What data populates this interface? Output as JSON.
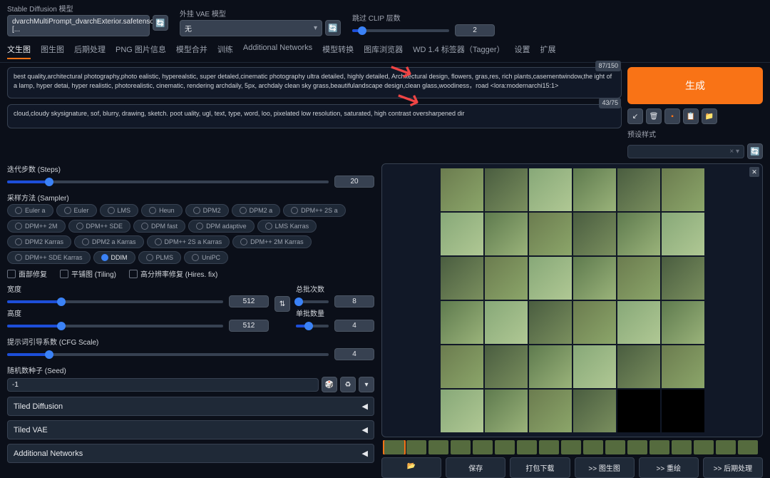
{
  "header": {
    "model_label": "Stable Diffusion 模型",
    "model_value": "dvarchMultiPrompt_dvarchExterior.safetensors [...",
    "vae_label": "外挂 VAE 模型",
    "vae_value": "无",
    "clip_label": "跳过 CLIP 层数",
    "clip_value": "2"
  },
  "tabs": [
    "文生图",
    "图生图",
    "后期处理",
    "PNG 图片信息",
    "模型合并",
    "训练",
    "Additional Networks",
    "模型转换",
    "图库浏览器",
    "WD 1.4 标签器（Tagger）",
    "设置",
    "扩展"
  ],
  "prompt": {
    "pos": "best quality,architectural photography,photo ealistic, hyperealstic, super detaled,cinematic photography ultra detailed, highly detailed, Architectural design, flowers, gras,res, rich plants,casementwindow,the ight of a lamp, hyper detai, hyper realistic, photorealistic, cinematic, rendering archdaily, 5px, archdaly clean sky grass,beautifulandscape design,clean glass,woodiness，road <lora:modernarchi15:1>",
    "pos_count": "87/150",
    "neg": "cloud,cloudy skysignature, sof, blurry, drawing, sketch. poot uality, ugl, text, type, word, loo, pixelated low resolution, saturated, high contrast oversharpened dir",
    "neg_count": "43/75"
  },
  "gen_btn": "生成",
  "preset_label": "预设样式",
  "preset_placeholder": "× ▾",
  "settings": {
    "steps_label": "迭代步数 (Steps)",
    "steps_value": "20",
    "sampler_label": "采样方法 (Sampler)",
    "samplers": [
      "Euler a",
      "Euler",
      "LMS",
      "Heun",
      "DPM2",
      "DPM2 a",
      "DPM++ 2S a",
      "DPM++ 2M",
      "DPM++ SDE",
      "DPM fast",
      "DPM adaptive",
      "LMS Karras",
      "DPM2 Karras",
      "DPM2 a Karras",
      "DPM++ 2S a Karras",
      "DPM++ 2M Karras",
      "DPM++ SDE Karras",
      "DDIM",
      "PLMS",
      "UniPC"
    ],
    "sampler_selected": "DDIM",
    "check1": "面部修复",
    "check2": "平铺图 (Tiling)",
    "check3": "高分辨率修复 (Hires. fix)",
    "width_label": "宽度",
    "width_value": "512",
    "height_label": "高度",
    "height_value": "512",
    "batch_count_label": "总批次数",
    "batch_count_value": "8",
    "batch_size_label": "单批数量",
    "batch_size_value": "4",
    "cfg_label": "提示词引导系数 (CFG Scale)",
    "cfg_value": "4",
    "seed_label": "随机数种子 (Seed)",
    "seed_value": "-1"
  },
  "accordions": [
    "Tiled Diffusion",
    "Tiled VAE",
    "Additional Networks"
  ],
  "actions": {
    "folder": "📂",
    "save": "保存",
    "zip": "打包下载",
    "img2img": ">> 图生图",
    "inpaint": ">> 重绘",
    "postproc": ">> 后期处理"
  }
}
